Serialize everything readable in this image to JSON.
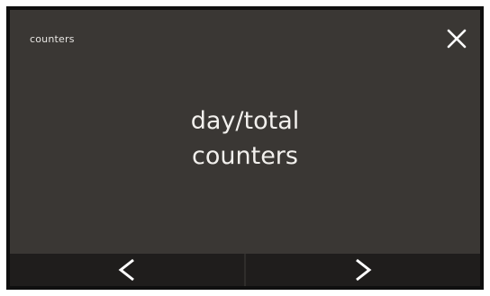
{
  "header": {
    "title": "counters",
    "close_icon": "close-icon"
  },
  "main": {
    "line1": "day/total",
    "line2": "counters"
  },
  "footer": {
    "prev_icon": "chevron-left-icon",
    "next_icon": "chevron-right-icon"
  },
  "colors": {
    "screen_bg": "#3a3734",
    "footer_bg": "#1f1d1c",
    "text": "#f2f0ed"
  }
}
